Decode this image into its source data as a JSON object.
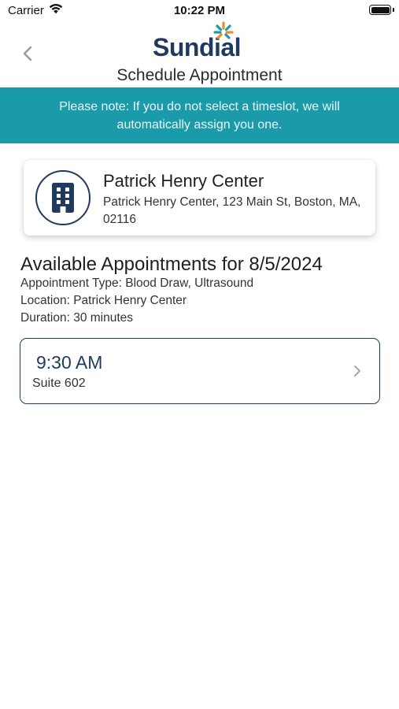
{
  "status_bar": {
    "carrier": "Carrier",
    "time": "10:22 PM"
  },
  "header": {
    "logo_text": "Sundial",
    "title": "Schedule Appointment",
    "back_icon": "chevron-left-icon"
  },
  "notice": {
    "text": "Please note: If you do not select a timeslot, we will automatically assign you one."
  },
  "location": {
    "icon": "building-icon",
    "name": "Patrick Henry Center",
    "address": "Patrick Henry Center, 123 Main St, Boston, MA, 02116"
  },
  "appointments": {
    "title": "Available Appointments for 8/5/2024",
    "type": "Appointment Type: Blood Draw, Ultrasound",
    "location": "Location: Patrick Henry Center",
    "duration": "Duration: 30 minutes",
    "slots": [
      {
        "time": "9:30 AM",
        "room": "Suite 602"
      }
    ]
  },
  "colors": {
    "brand_navy": "#1e3a5f",
    "banner_teal": "#1b9aa9",
    "logo_orange": "#f08a24",
    "logo_teal": "#1b9aa9"
  }
}
